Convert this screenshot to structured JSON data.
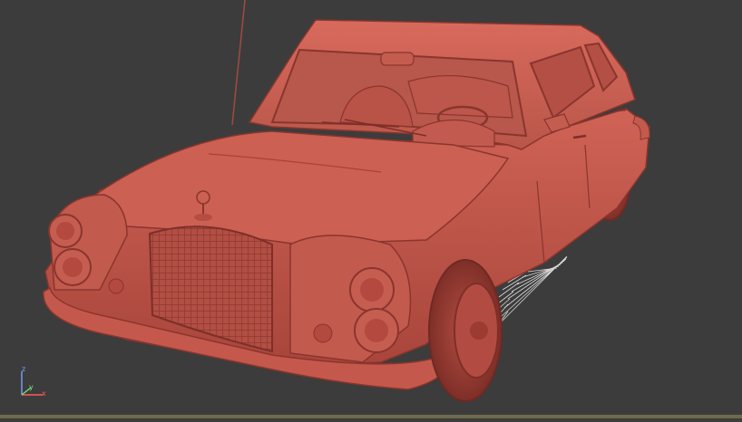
{
  "viewport": {
    "type": "perspective-3d-viewport",
    "background": "#3c3c3c",
    "subject": "car-model",
    "model_color": "#c8574c",
    "grid_color": "#d8d8d8"
  },
  "gizmo": {
    "z_label": "z",
    "y_label": "y",
    "x_label": "x",
    "colors": {
      "x": "#ff5a5a",
      "y": "#6ee06e",
      "z": "#7aa0ff"
    }
  },
  "statusbar": {
    "color": "#6e6a4e"
  }
}
